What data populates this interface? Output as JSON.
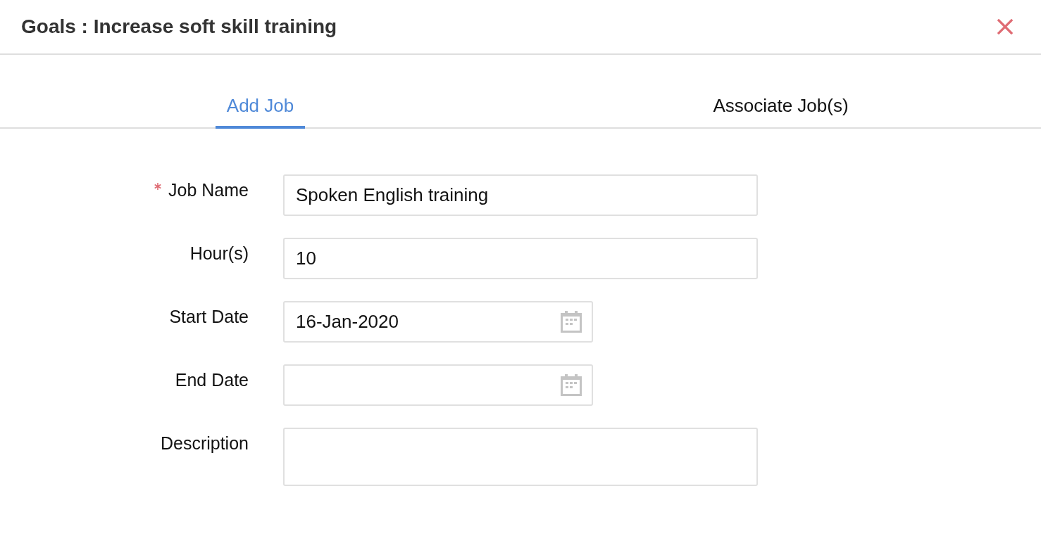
{
  "dialog": {
    "title": "Goals : Increase soft skill training"
  },
  "tabs": [
    {
      "label": "Add Job",
      "selected": true
    },
    {
      "label": "Associate Job(s)",
      "selected": false
    }
  ],
  "form": {
    "fields": [
      {
        "kind": "text",
        "label": "Job Name",
        "required": true,
        "value": "Spoken English training"
      },
      {
        "kind": "text",
        "label": "Hour(s)",
        "required": false,
        "value": "10"
      },
      {
        "kind": "date",
        "label": "Start Date",
        "required": false,
        "value": "16-Jan-2020"
      },
      {
        "kind": "date",
        "label": "End Date",
        "required": false
      },
      {
        "kind": "textarea",
        "label": "Description",
        "required": false
      }
    ]
  }
}
